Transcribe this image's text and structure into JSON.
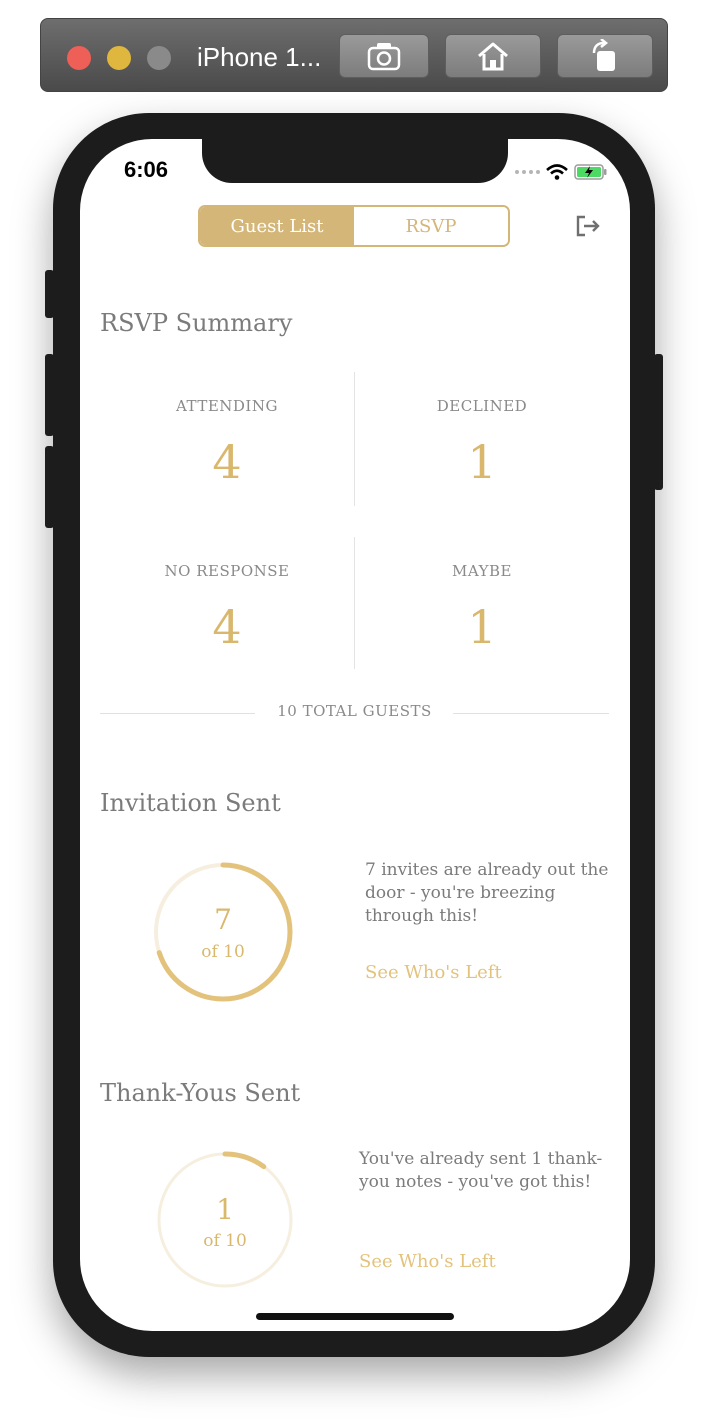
{
  "simulator": {
    "window_title": "iPhone 1...",
    "buttons": [
      "camera-icon",
      "home-icon",
      "rotate-icon"
    ]
  },
  "status_bar": {
    "time": "6:06",
    "icons": [
      "signal-dots-icon",
      "wifi-icon",
      "battery-charging-icon"
    ]
  },
  "header": {
    "tabs": [
      {
        "label": "Guest List",
        "active": true
      },
      {
        "label": "RSVP",
        "active": false
      }
    ],
    "logout_icon": "logout-icon"
  },
  "rsvp_summary": {
    "title": "RSVP Summary",
    "cells": [
      {
        "label": "ATTENDING",
        "value": "4"
      },
      {
        "label": "DECLINED",
        "value": "1"
      },
      {
        "label": "NO RESPONSE",
        "value": "4"
      },
      {
        "label": "MAYBE",
        "value": "1"
      }
    ],
    "total": "10 TOTAL GUESTS"
  },
  "invitations": {
    "title": "Invitation Sent",
    "count": "7",
    "of_text": "of 10",
    "progress": 0.7,
    "description": "7 invites are already out the door - you're breezing through this!",
    "link": "See Who's Left"
  },
  "thank_yous": {
    "title": "Thank-Yous Sent",
    "count": "1",
    "of_text": "of 10",
    "progress": 0.1,
    "description": "You've already sent 1 thank-you notes - you've got this!",
    "link": "See Who's Left"
  },
  "colors": {
    "accent": "#d4b679",
    "accent_light": "#e3c27c",
    "text_gray": "#7b7b7b"
  }
}
